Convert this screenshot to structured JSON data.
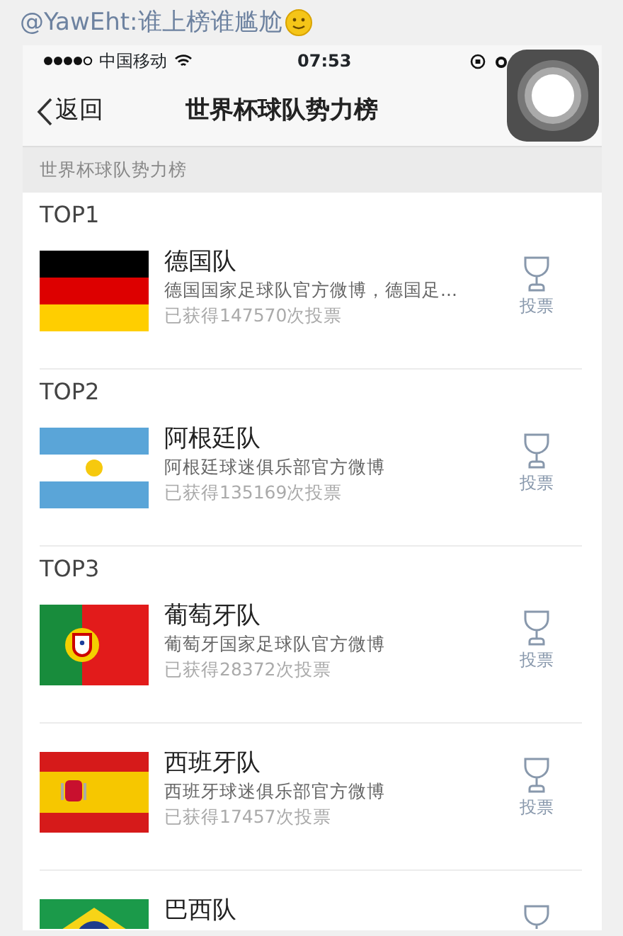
{
  "caption": "@YawEht:谁上榜谁尴尬",
  "status_bar": {
    "carrier": "中国移动",
    "time": "07:53"
  },
  "nav": {
    "back": "返回",
    "title": "世界杯球队势力榜"
  },
  "section_header": "世界杯球队势力榜",
  "teams": [
    {
      "rank": "TOP1",
      "name": "德国队",
      "description": "德国国家足球队官方微博，德国足...",
      "votes": "已获得147570次投票",
      "vote_button": "投票"
    },
    {
      "rank": "TOP2",
      "name": "阿根廷队",
      "description": "阿根廷球迷俱乐部官方微博",
      "votes": "已获得135169次投票",
      "vote_button": "投票"
    },
    {
      "rank": "TOP3",
      "name": "葡萄牙队",
      "description": "葡萄牙国家足球队官方微博",
      "votes": "已获得28372次投票",
      "vote_button": "投票"
    },
    {
      "name": "西班牙队",
      "description": "西班牙球迷俱乐部官方微博",
      "votes": "已获得17457次投票",
      "vote_button": "投票"
    },
    {
      "name": "巴西队"
    }
  ]
}
